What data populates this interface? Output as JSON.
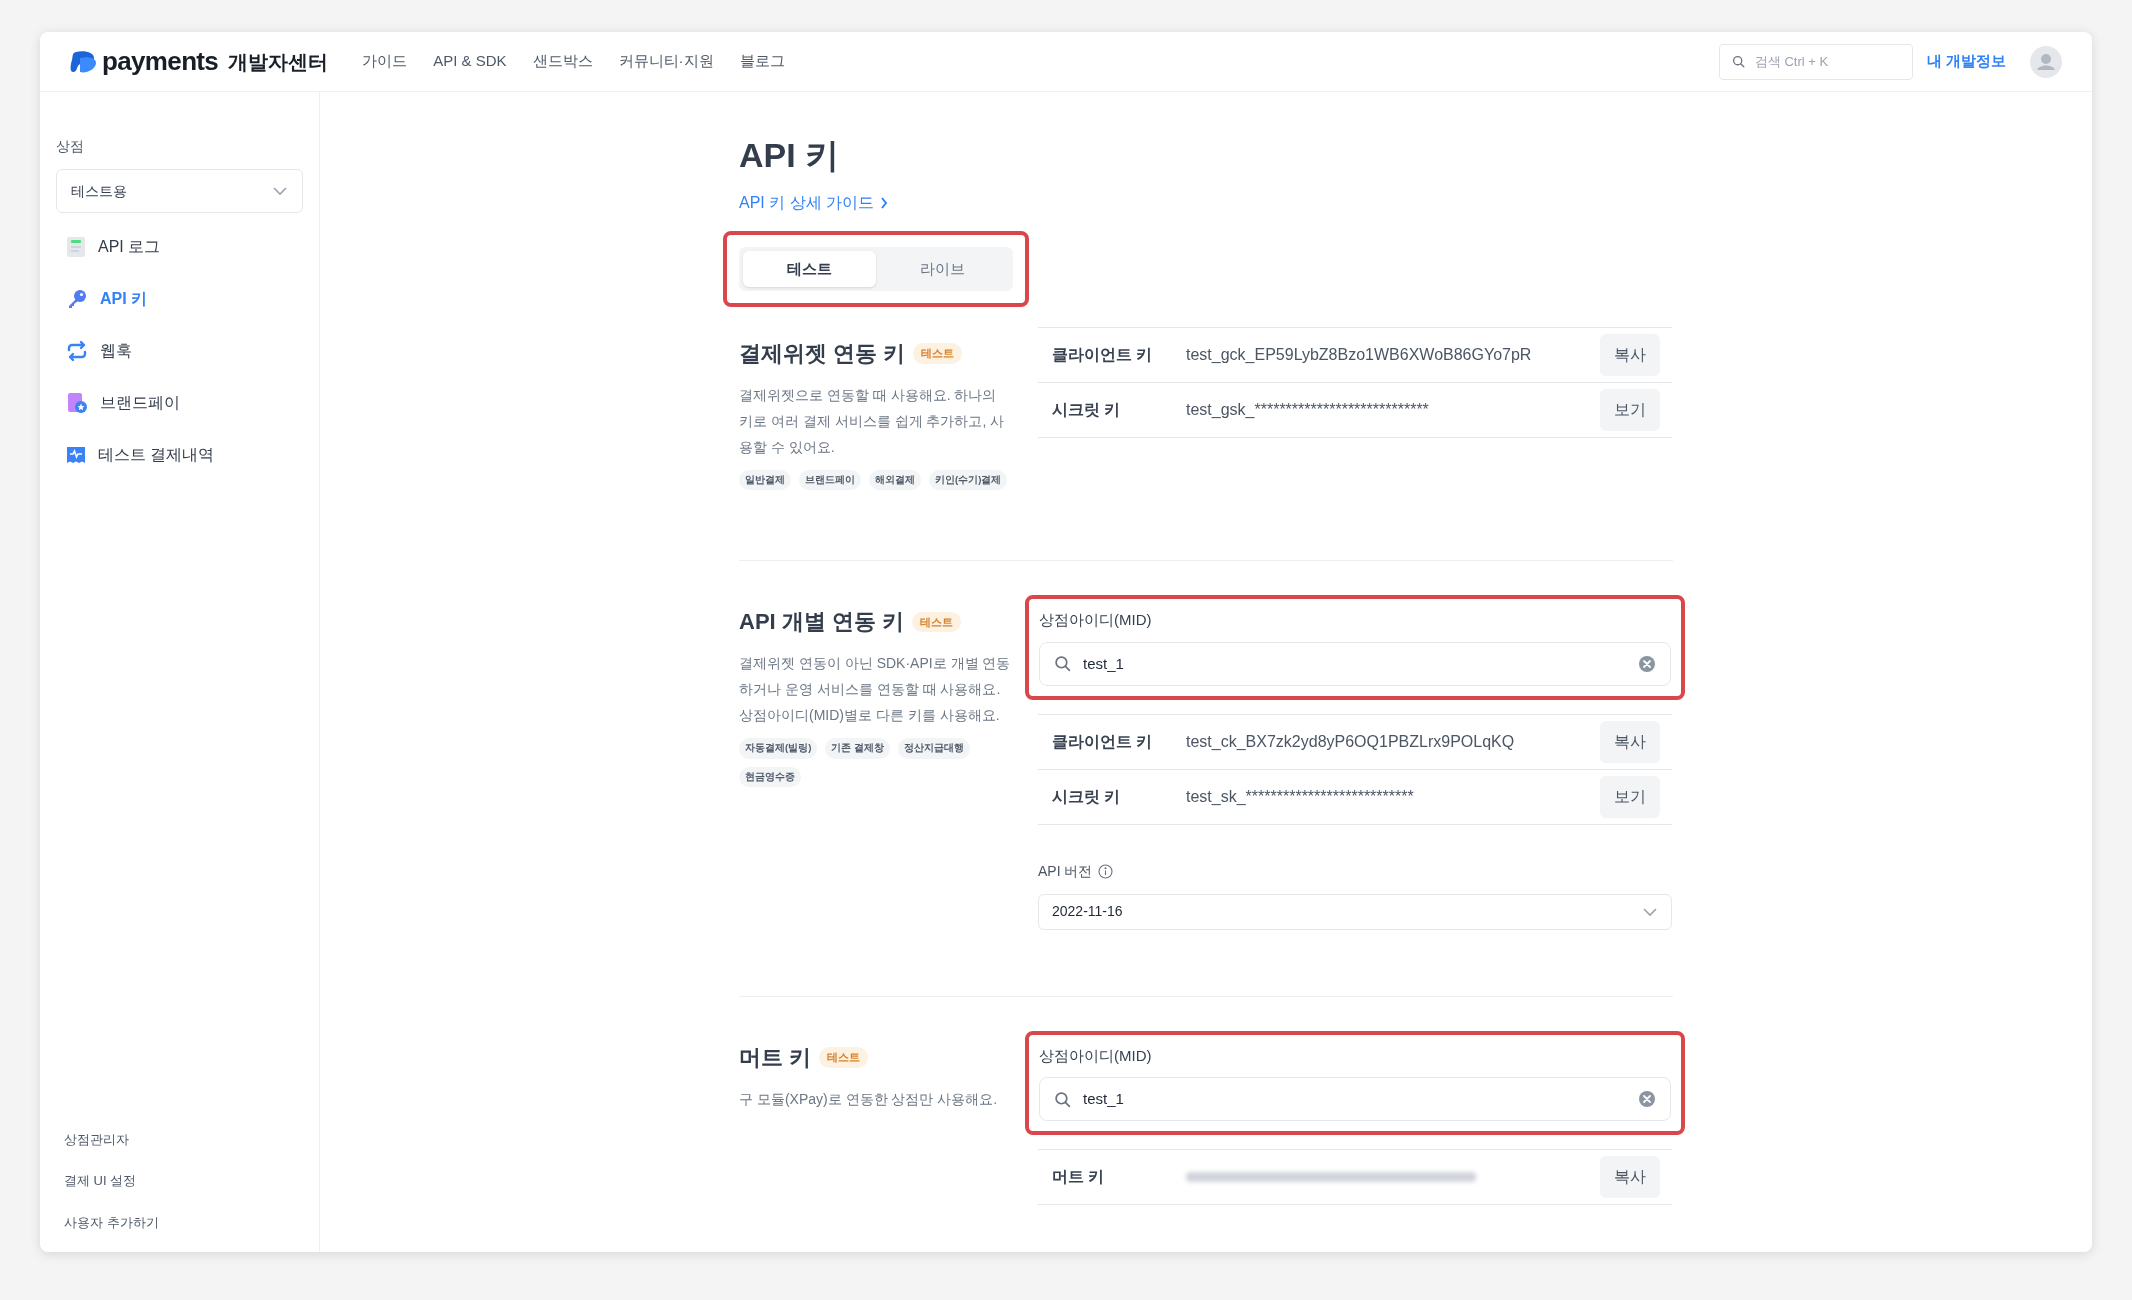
{
  "header": {
    "logo": {
      "wordmark": "payments",
      "suffix": "개발자센터"
    },
    "nav": [
      {
        "label": "가이드"
      },
      {
        "label": "API & SDK"
      },
      {
        "label": "샌드박스"
      },
      {
        "label": "커뮤니티·지원"
      },
      {
        "label": "블로그"
      }
    ],
    "search": {
      "placeholder": "검색 Ctrl + K"
    },
    "profile_link": "내 개발정보"
  },
  "sidebar": {
    "store_label": "상점",
    "store_select": "테스트용",
    "items": [
      {
        "label": "API 로그",
        "selected": false
      },
      {
        "label": "API 키",
        "selected": true
      },
      {
        "label": "웹훅",
        "selected": false
      },
      {
        "label": "브랜드페이",
        "selected": false
      },
      {
        "label": "테스트 결제내역",
        "selected": false
      }
    ],
    "footer_links": [
      "상점관리자",
      "결제 UI 설정",
      "사용자 추가하기"
    ]
  },
  "page": {
    "title": "API 키",
    "guide_link": "API 키 상세 가이드",
    "environment_tabs": {
      "highlighted": true,
      "tabs": [
        {
          "label": "테스트",
          "selected": true
        },
        {
          "label": "라이브",
          "selected": false
        }
      ]
    },
    "sections": [
      {
        "title": "결제위젯 연동 키",
        "badge": "테스트",
        "description": "결제위젯으로 연동할 때 사용해요. 하나의 키로 여러 결제 서비스를 쉽게 추가하고, 사용할 수 있어요.",
        "tags": [
          "일반결제",
          "브랜드페이",
          "해외결제",
          "키인(수기)결제"
        ],
        "keys": [
          {
            "label": "클라이언트 키",
            "value": "test_gck_EP59LybZ8Bzo1WB6XWoB86GYo7pR",
            "action": "복사"
          },
          {
            "label": "시크릿 키",
            "value": "test_gsk_****************************",
            "action": "보기"
          }
        ]
      },
      {
        "title": "API 개별 연동 키",
        "badge": "테스트",
        "description": "결제위젯 연동이 아닌 SDK·API로 개별 연동하거나 운영 서비스를 연동할 때 사용해요. 상점아이디(MID)별로 다른 키를 사용해요.",
        "tags": [
          "자동결제(빌링)",
          "기존 결제창",
          "정산지급대행",
          "현금영수증"
        ],
        "mid_field": {
          "label": "상점아이디(MID)",
          "value": "test_1",
          "highlighted": true
        },
        "keys": [
          {
            "label": "클라이언트 키",
            "value": "test_ck_BX7zk2yd8yP6OQ1PBZLrx9POLqKQ",
            "action": "복사"
          },
          {
            "label": "시크릿 키",
            "value": "test_sk_***************************",
            "action": "보기"
          }
        ],
        "api_version": {
          "label": "API 버전",
          "value": "2022-11-16"
        }
      },
      {
        "title": "머트 키",
        "badge": "테스트",
        "description": "구 모듈(XPay)로 연동한 상점만 사용해요.",
        "mid_field": {
          "label": "상점아이디(MID)",
          "value": "test_1",
          "highlighted": true
        },
        "keys": [
          {
            "label": "머트 키",
            "blurred": true,
            "action": "복사"
          }
        ]
      }
    ]
  }
}
